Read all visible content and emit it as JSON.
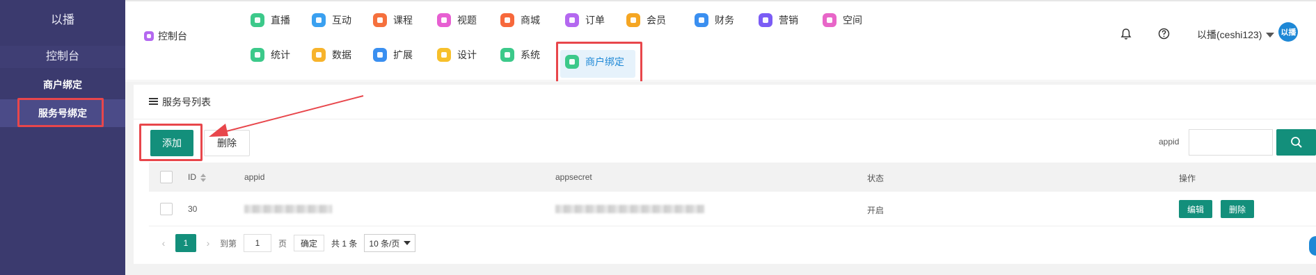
{
  "sidebar": {
    "brand": "以播",
    "console": "控制台",
    "group": "商户绑定",
    "active_item": "服务号绑定"
  },
  "topnav": {
    "home": "控制台",
    "row1": [
      {
        "label": "直播",
        "icon": "live-icon",
        "color": "#3cc98a"
      },
      {
        "label": "互动",
        "icon": "chat-icon",
        "color": "#3aa0f0"
      },
      {
        "label": "课程",
        "icon": "course-icon",
        "color": "#f5703d"
      },
      {
        "label": "视题",
        "icon": "video-icon",
        "color": "#e75fd2"
      },
      {
        "label": "商城",
        "icon": "shop-icon",
        "color": "#f7683b"
      },
      {
        "label": "订单",
        "icon": "order-icon",
        "color": "#b468f0"
      },
      {
        "label": "会员",
        "icon": "member-icon",
        "color": "#f5a623"
      },
      {
        "label": "财务",
        "icon": "finance-icon",
        "color": "#3a8ff0"
      },
      {
        "label": "营销",
        "icon": "marketing-icon",
        "color": "#7b5cf5"
      },
      {
        "label": "空间",
        "icon": "space-icon",
        "color": "#e866c8"
      }
    ],
    "row2": [
      {
        "label": "统计",
        "icon": "stats-icon",
        "color": "#3cc98a"
      },
      {
        "label": "数据",
        "icon": "data-icon",
        "color": "#f7b32b"
      },
      {
        "label": "扩展",
        "icon": "extend-icon",
        "color": "#3a8ff0"
      },
      {
        "label": "设计",
        "icon": "design-icon",
        "color": "#f7c02b"
      },
      {
        "label": "系统",
        "icon": "system-icon",
        "color": "#3cc98a"
      },
      {
        "label": "商户绑定",
        "icon": "merchant-bind-icon",
        "color": "#3cc98a"
      }
    ],
    "user": "以播(ceshi123)",
    "avatar_text": "以播"
  },
  "panel": {
    "title": "服务号列表",
    "add_label": "添加",
    "delete_label": "删除",
    "search_label": "appid",
    "search_value": ""
  },
  "table": {
    "headers": [
      "ID",
      "appid",
      "appsecret",
      "状态",
      "操作"
    ],
    "rows": [
      {
        "id": "30",
        "status": "开启",
        "edit_label": "编辑",
        "delete_label": "删除"
      }
    ]
  },
  "pagination": {
    "current": "1",
    "goto_label": "到第",
    "goto_value": "1",
    "page_label": "页",
    "confirm_label": "确定",
    "total": "共 1 条",
    "page_size": "10 条/页"
  },
  "colors": {
    "sidebar": "#3b3a6e",
    "primary": "#138f7b",
    "highlight": "#e8464b"
  }
}
